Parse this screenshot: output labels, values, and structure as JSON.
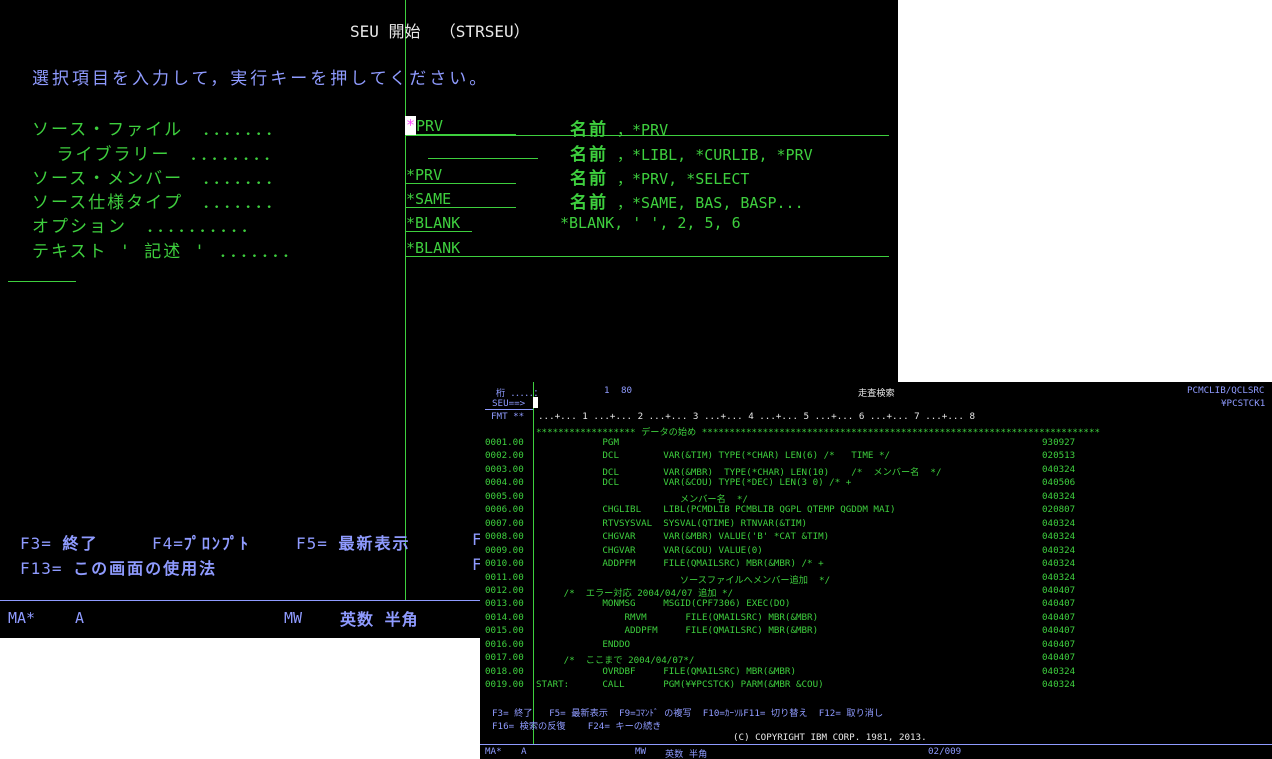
{
  "screen1": {
    "title": "SEU 開始  （STRSEU）",
    "instruction": "選択項目を入力して，実行キーを押してください。",
    "fields": [
      {
        "label": "ソース・ファイル　．．．．．．．",
        "value": "*PRV",
        "desc": "名前 ，*PRV"
      },
      {
        "label": "  ライブラリー　．．．．．．．．",
        "value": "",
        "desc": "名前 ，*LIBL, *CURLIB, *PRV"
      },
      {
        "label": "ソース・メンバー　．．．．．．．",
        "value": "*PRV",
        "desc": "名前 ，*PRV, *SELECT"
      },
      {
        "label": "ソース仕様タイプ　．．．．．．．",
        "value": "*SAME",
        "desc": "名前 ，*SAME, BAS, BASP..."
      },
      {
        "label": "オプション　．．．．．．．．．．",
        "value": "*BLANK",
        "desc": "*BLANK, ' ', 2, 5, 6"
      },
      {
        "label": "テキスト ' 記述 ' ．．．．．．．",
        "value": "*BLANK",
        "desc": ""
      }
    ],
    "function_keys": {
      "row1": [
        {
          "key": "F3=",
          "label": "終了"
        },
        {
          "key": "F4=",
          "label": "ﾌﾟﾛﾝﾌﾟﾄ"
        },
        {
          "key": "F5=",
          "label": "最新表示"
        },
        {
          "key": "F",
          "label": ""
        }
      ],
      "row2": [
        {
          "key": "F13=",
          "label": "この画面の使用法"
        },
        {
          "key": "F",
          "label": ""
        }
      ]
    },
    "status": {
      "left": "MA*",
      "mode": "A",
      "mw": "MW",
      "ime": "英数 半角"
    }
  },
  "screen2": {
    "header": {
      "col_label": "桁 ．．．．．：",
      "col_from": "1",
      "col_to": "80",
      "title": "走査検索",
      "file": "PCMCLIB/QCLSRC",
      "member": "¥PCSTCK1"
    },
    "command_prompt": "SEU==>",
    "fmt_label": "FMT **",
    "ruler": "...+... 1 ...+... 2 ...+... 3 ...+... 4 ...+... 5 ...+... 6 ...+... 7 ...+... 8",
    "data_start": "****************** データの始め ************************************************************************",
    "lines": [
      {
        "seq": "0001.00",
        "src": "            PGM",
        "date": "930927"
      },
      {
        "seq": "0002.00",
        "src": "            DCL        VAR(&TIM) TYPE(*CHAR) LEN(6) /*   TIME */",
        "date": "020513"
      },
      {
        "seq": "0003.00",
        "src": "            DCL        VAR(&MBR)  TYPE(*CHAR) LEN(10)    /*  メンバー名  */",
        "date": "040324"
      },
      {
        "seq": "0004.00",
        "src": "            DCL        VAR(&COU) TYPE(*DEC) LEN(3 0) /* +",
        "date": "040506"
      },
      {
        "seq": "0005.00",
        "src": "                          メンバー名  */",
        "date": "040324"
      },
      {
        "seq": "0006.00",
        "src": "            CHGLIBL    LIBL(PCMDLIB PCMBLIB QGPL QTEMP QGDDM MAI)",
        "date": "020807"
      },
      {
        "seq": "0007.00",
        "src": "            RTVSYSVAL  SYSVAL(QTIME) RTNVAR(&TIM)",
        "date": "040324"
      },
      {
        "seq": "0008.00",
        "src": "            CHGVAR     VAR(&MBR) VALUE('B' *CAT &TIM)",
        "date": "040324"
      },
      {
        "seq": "0009.00",
        "src": "            CHGVAR     VAR(&COU) VALUE(0)",
        "date": "040324"
      },
      {
        "seq": "0010.00",
        "src": "            ADDPFM     FILE(QMAILSRC) MBR(&MBR) /* +",
        "date": "040324"
      },
      {
        "seq": "0011.00",
        "src": "                          ソースファイルへメンバー追加  */",
        "date": "040324"
      },
      {
        "seq": "0012.00",
        "src": "     /*  エラー対応 2004/04/07 追加 */",
        "date": "040407"
      },
      {
        "seq": "0013.00",
        "src": "            MONMSG     MSGID(CPF7306) EXEC(DO)",
        "date": "040407"
      },
      {
        "seq": "0014.00",
        "src": "                RMVM       FILE(QMAILSRC) MBR(&MBR)",
        "date": "040407"
      },
      {
        "seq": "0015.00",
        "src": "                ADDPFM     FILE(QMAILSRC) MBR(&MBR)",
        "date": "040407"
      },
      {
        "seq": "0016.00",
        "src": "            ENDDO",
        "date": "040407"
      },
      {
        "seq": "0017.00",
        "src": "     /*  ここまで 2004/04/07*/",
        "date": "040407"
      },
      {
        "seq": "0018.00",
        "src": "            OVRDBF     FILE(QMAILSRC) MBR(&MBR)",
        "date": "040324"
      },
      {
        "seq": "0019.00",
        "src": "START:      CALL       PGM(¥¥PCSTCK) PARM(&MBR &COU)",
        "date": "040324"
      }
    ],
    "fkeys_row1": "F3= 終了   F5= 最新表示  F9=ｺﾏﾝﾄﾞ の複写  F10=ｶｰｿﾙF11= 切り替え  F12= 取り消し",
    "fkeys_row2": "F16= 検索の反復    F24= キーの続き",
    "copyright": "(C) COPYRIGHT IBM CORP. 1981, 2013.",
    "status": {
      "left": "MA*",
      "mode": "A",
      "mw": "MW",
      "ime": "英数 半角",
      "pos": "02/009"
    }
  }
}
